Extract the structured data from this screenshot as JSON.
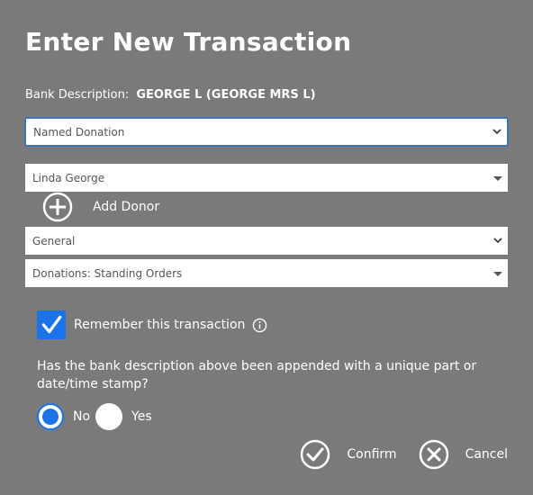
{
  "dialog": {
    "title": "Enter New Transaction",
    "bank_description_label": "Bank Description:",
    "bank_description_value": "GEORGE L (GEORGE MRS L)"
  },
  "fields": {
    "transaction_type": "Named Donation",
    "donor": "Linda George",
    "fund": "General",
    "category": "Donations: Standing Orders"
  },
  "add_donor": {
    "label": "Add Donor"
  },
  "remember": {
    "label": "Remember this transaction",
    "checked": true
  },
  "question": {
    "text": "Has the bank description above been appended with a unique part or date/time stamp?",
    "options": [
      "No",
      "Yes"
    ],
    "selected": "No"
  },
  "actions": {
    "confirm": "Confirm",
    "cancel": "Cancel"
  },
  "colors": {
    "background": "#7a7a7a",
    "accent": "#1a73e8",
    "focus_border": "#3d74b8"
  }
}
